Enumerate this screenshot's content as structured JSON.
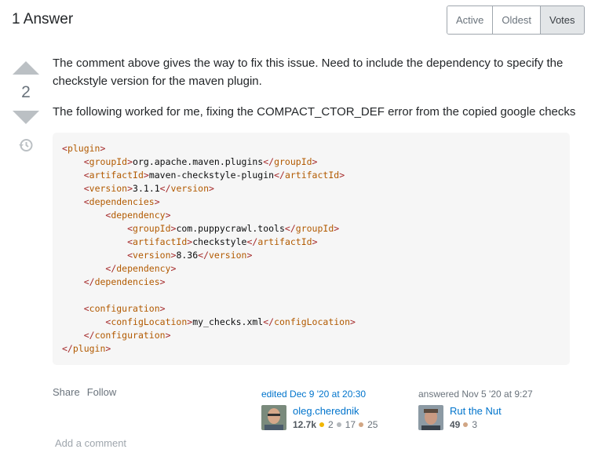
{
  "header": {
    "title": "1 Answer"
  },
  "sort": {
    "active": "Active",
    "oldest": "Oldest",
    "votes": "Votes"
  },
  "vote": {
    "count": "2"
  },
  "post": {
    "p1": "The comment above gives the way to fix this issue. Need to include the dependency to specify the checkstyle version for the maven plugin.",
    "p2": "The following worked for me, fixing the COMPACT_CTOR_DEF error from the copied google checks"
  },
  "code": {
    "lines": [
      {
        "indent": 0,
        "tag": "plugin",
        "type": "open"
      },
      {
        "indent": 1,
        "tag": "groupId",
        "text": "org.apache.maven.plugins",
        "type": "full"
      },
      {
        "indent": 1,
        "tag": "artifactId",
        "text": "maven-checkstyle-plugin",
        "type": "full"
      },
      {
        "indent": 1,
        "tag": "version",
        "text": "3.1.1",
        "type": "full"
      },
      {
        "indent": 1,
        "tag": "dependencies",
        "type": "open"
      },
      {
        "indent": 2,
        "tag": "dependency",
        "type": "open"
      },
      {
        "indent": 3,
        "tag": "groupId",
        "text": "com.puppycrawl.tools",
        "type": "full"
      },
      {
        "indent": 3,
        "tag": "artifactId",
        "text": "checkstyle",
        "type": "full"
      },
      {
        "indent": 3,
        "tag": "version",
        "text": "8.36",
        "type": "full"
      },
      {
        "indent": 2,
        "tag": "dependency",
        "type": "close"
      },
      {
        "indent": 1,
        "tag": "dependencies",
        "type": "close"
      },
      {
        "indent": 0,
        "type": "blank"
      },
      {
        "indent": 1,
        "tag": "configuration",
        "type": "open"
      },
      {
        "indent": 2,
        "tag": "configLocation",
        "text": "my_checks.xml",
        "type": "full"
      },
      {
        "indent": 1,
        "tag": "configuration",
        "type": "close"
      },
      {
        "indent": 0,
        "tag": "plugin",
        "type": "close"
      }
    ]
  },
  "actions": {
    "share": "Share",
    "follow": "Follow"
  },
  "edited": {
    "action": "edited Dec 9 '20 at 20:30",
    "user": "oleg.cherednik",
    "rep": "12.7k",
    "gold": "2",
    "silver": "17",
    "bronze": "25"
  },
  "answered": {
    "action": "answered Nov 5 '20 at 9:27",
    "user": "Rut the Nut",
    "rep": "49",
    "bronze": "3"
  },
  "comment": {
    "add": "Add a comment"
  },
  "colors": {
    "gold": "#f1b600",
    "silver": "#b4b8bc",
    "bronze": "#d1a684",
    "link": "#0074cc",
    "tag": "#b25a00"
  }
}
